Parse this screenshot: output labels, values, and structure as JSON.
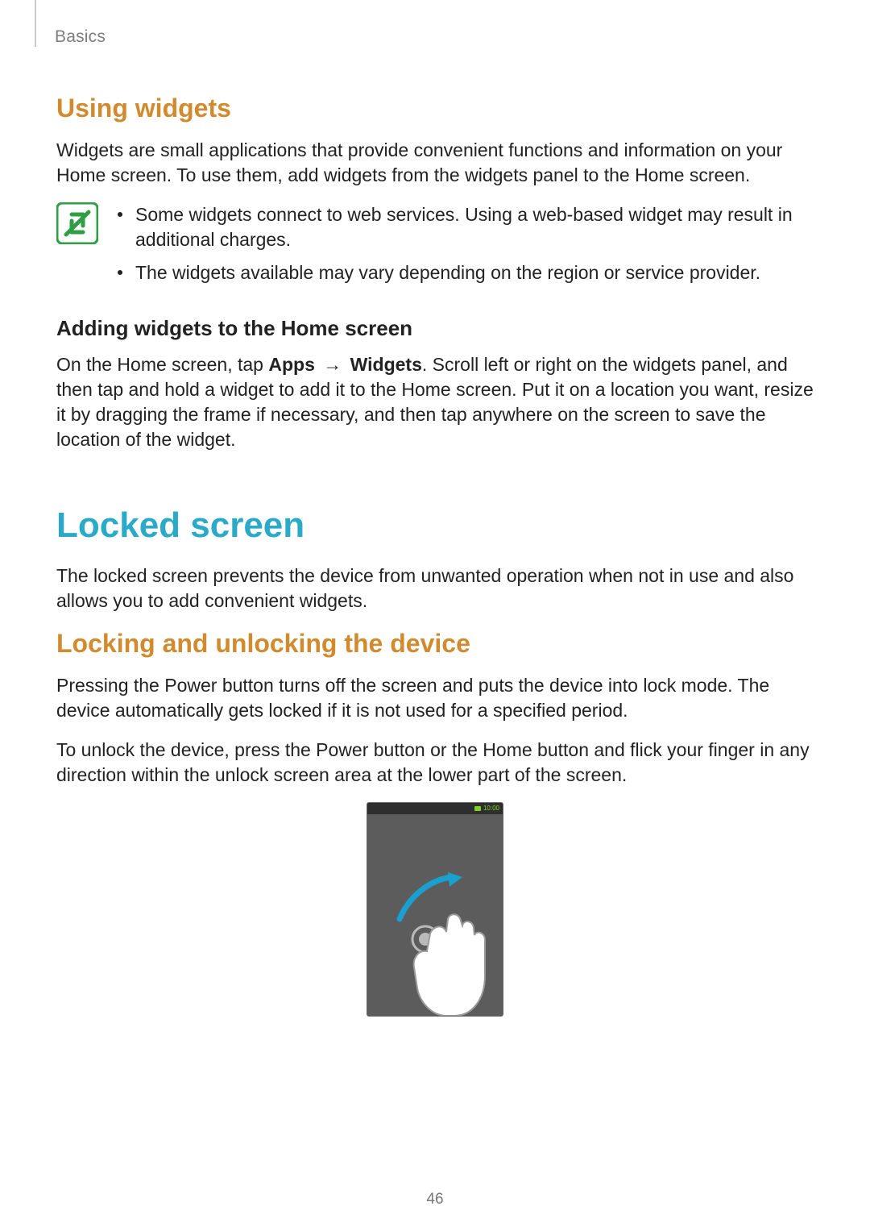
{
  "breadcrumb": "Basics",
  "page_number": "46",
  "section_using_widgets": {
    "title": "Using widgets",
    "intro": "Widgets are small applications that provide convenient functions and information on your Home screen. To use them, add widgets from the widgets panel to the Home screen.",
    "notes": [
      "Some widgets connect to web services. Using a web-based widget may result in additional charges.",
      "The widgets available may vary depending on the region or service provider."
    ],
    "sub_title": "Adding widgets to the Home screen",
    "sub_pre": "On the Home screen, tap ",
    "sub_bold1": "Apps",
    "sub_arrow": "→",
    "sub_bold2": "Widgets",
    "sub_post": ". Scroll left or right on the widgets panel, and then tap and hold a widget to add it to the Home screen. Put it on a location you want, resize it by dragging the frame if necessary, and then tap anywhere on the screen to save the location of the widget."
  },
  "chapter_locked": {
    "title": "Locked screen",
    "intro": "The locked screen prevents the device from unwanted operation when not in use and also allows you to add convenient widgets."
  },
  "section_locking": {
    "title": "Locking and unlocking the device",
    "p1": "Pressing the Power button turns off the screen and puts the device into lock mode. The device automatically gets locked if it is not used for a specified period.",
    "p2": "To unlock the device, press the Power button or the Home button and flick your finger in any direction within the unlock screen area at the lower part of the screen."
  },
  "figure": {
    "status_time": "10:00"
  }
}
